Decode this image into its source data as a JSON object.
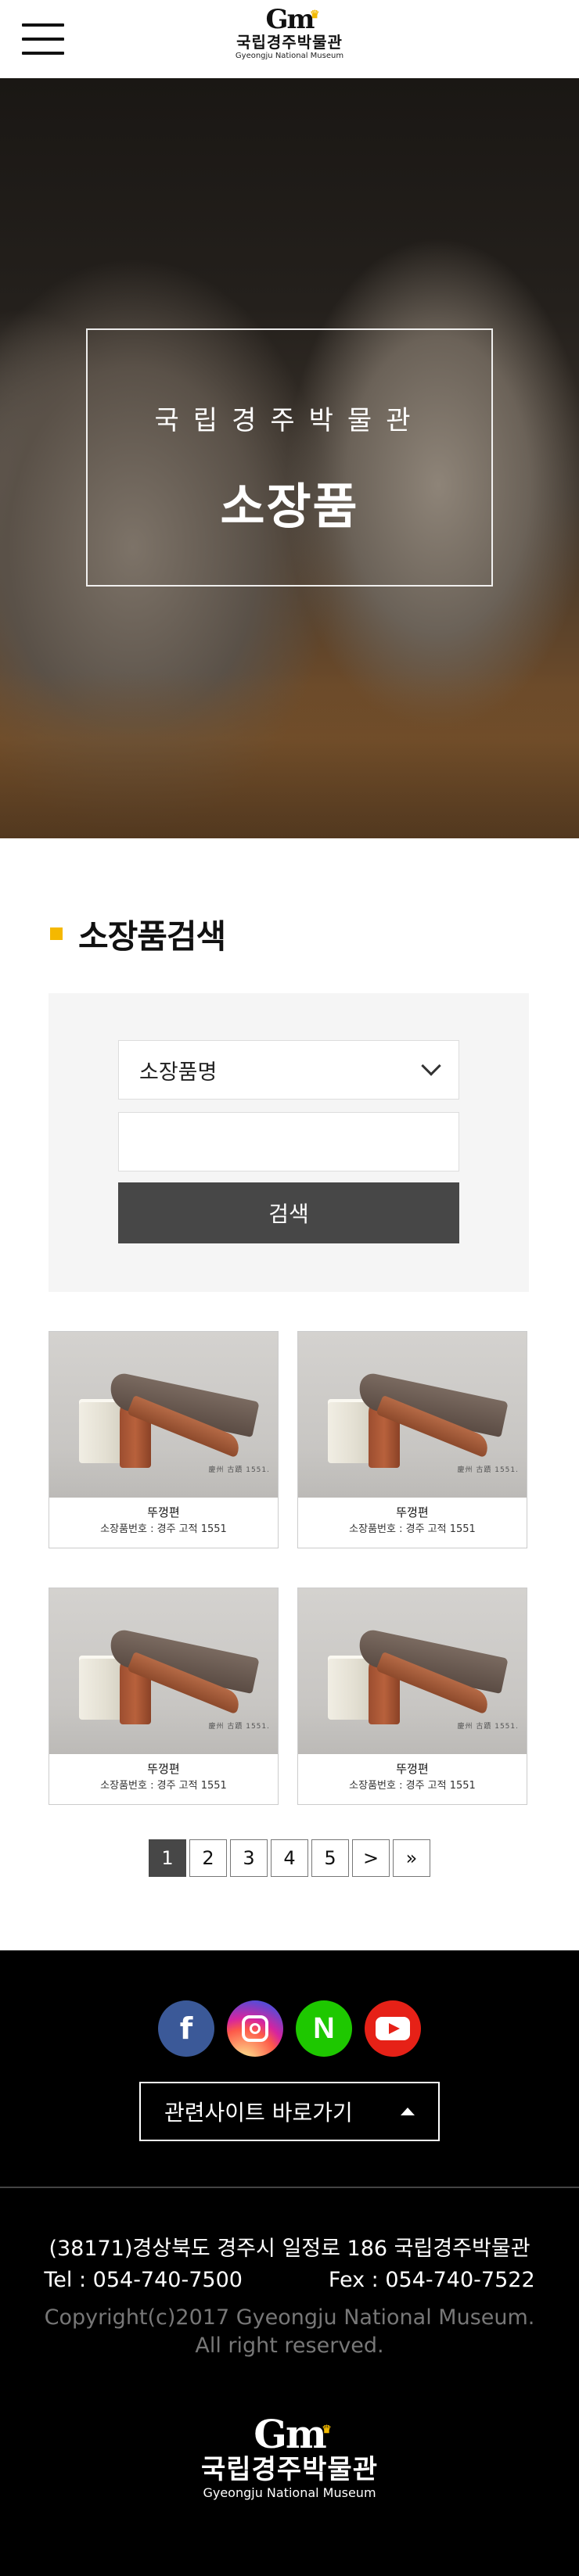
{
  "header": {
    "logo_mark": "Gm",
    "logo_ko": "국립경주박물관",
    "logo_en": "Gyeongju National Museum"
  },
  "hero": {
    "subtitle": "국립경주박물관",
    "title": "소장품"
  },
  "search": {
    "title": "소장품검색",
    "select_value": "소장품명",
    "input_value": "",
    "button_label": "검색"
  },
  "items": [
    {
      "name": "뚜껑편",
      "number": "소장품번호 : 경주 고적 1551",
      "tag": "慶州 古蹟 1551."
    },
    {
      "name": "뚜껑편",
      "number": "소장품번호 : 경주 고적 1551",
      "tag": "慶州 古蹟 1551."
    },
    {
      "name": "뚜껑편",
      "number": "소장품번호 : 경주 고적 1551",
      "tag": "慶州 古蹟 1551."
    },
    {
      "name": "뚜껑편",
      "number": "소장품번호 : 경주 고적 1551",
      "tag": "慶州 古蹟 1551."
    }
  ],
  "pagination": {
    "pages": [
      "1",
      "2",
      "3",
      "4",
      "5"
    ],
    "current": "1",
    "next": ">",
    "last": "»"
  },
  "footer": {
    "socials": {
      "facebook": "f",
      "naver": "N"
    },
    "related_label": "관련사이트 바로가기",
    "address": "(38171)경상북도 경주시 일정로 186 국립경주박물관",
    "tel": "Tel : 054-740-7500",
    "fax": "Fex : 054-740-7522",
    "copyright_line1": "Copyright(c)2017 Gyeongju National Museum.",
    "copyright_line2": "All right reserved.",
    "logo_mark": "Gm",
    "logo_ko": "국립경주박물관",
    "logo_en": "Gyeongju National Museum"
  },
  "colors": {
    "accent": "#f5b800",
    "button_dark": "#474747",
    "footer_bg": "#000000"
  }
}
